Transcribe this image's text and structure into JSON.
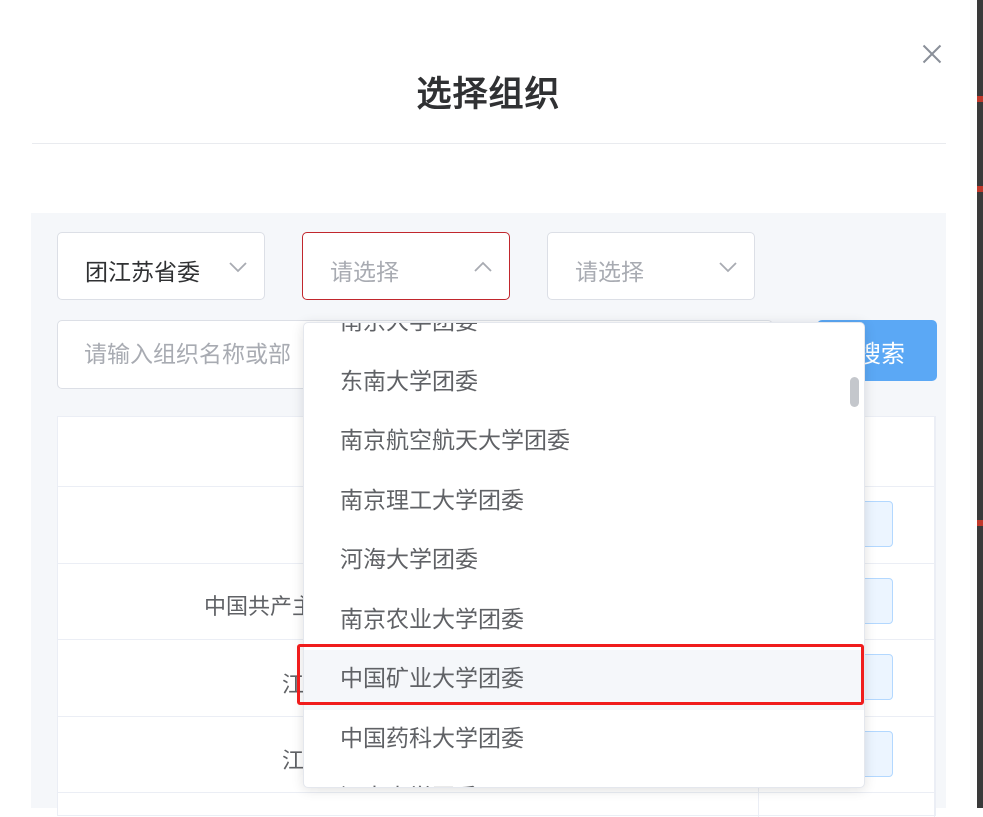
{
  "dialog": {
    "title": "选择组织",
    "close_icon": "close-icon"
  },
  "filters": {
    "province": {
      "value": "团江苏省委",
      "icon": "chevron-down-icon"
    },
    "school": {
      "placeholder": "请选择",
      "icon": "chevron-up-icon",
      "open": true
    },
    "level3": {
      "placeholder": "请选择",
      "icon": "chevron-down-icon"
    }
  },
  "search": {
    "placeholder": "请输入组织名称或部",
    "button_label": "搜索",
    "button_visible_text": "搜索"
  },
  "table": {
    "rows": [
      {
        "visible_text": ""
      },
      {
        "visible_text": "中国共产主"
      },
      {
        "visible_text": "江"
      },
      {
        "visible_text": "江"
      }
    ]
  },
  "dropdown": {
    "options": [
      "南京大学团委",
      "东南大学团委",
      "南京航空航天大学团委",
      "南京理工大学团委",
      "河海大学团委",
      "南京农业大学团委",
      "中国矿业大学团委",
      "中国药科大学团委",
      "江南大学团委"
    ],
    "hovered": "中国矿业大学团委",
    "highlight_color": "#f01c1c"
  },
  "colors": {
    "primary": "#5ba8f5",
    "active_border": "#c1272d",
    "highlight": "#f01c1c"
  }
}
